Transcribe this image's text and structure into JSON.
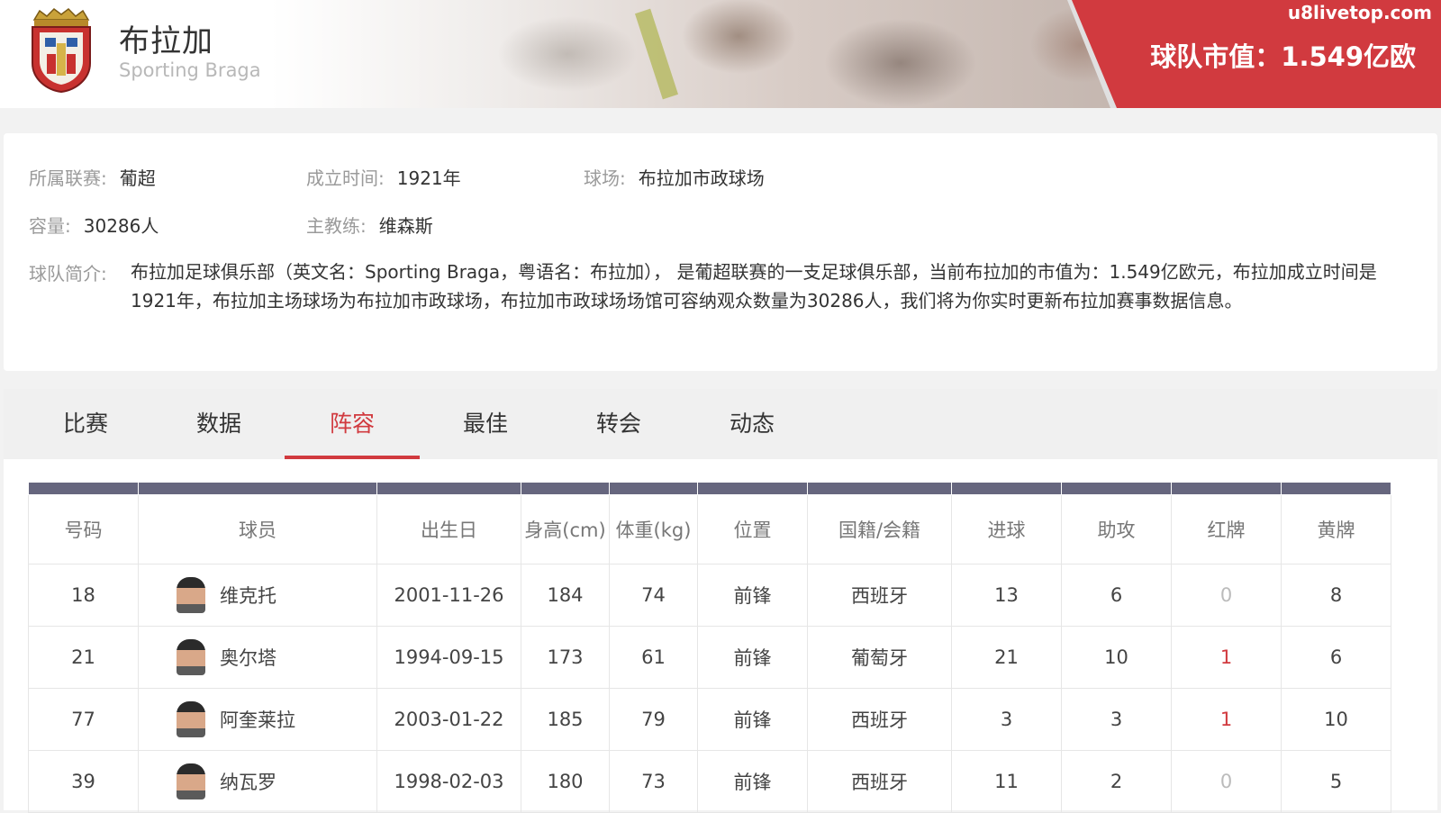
{
  "header": {
    "team_name": "布拉加",
    "team_name_en": "Sporting Braga",
    "watermark": "u8livetop.com",
    "market_value": "球队市值：1.549亿欧"
  },
  "info": {
    "league_label": "所属联赛:",
    "league": "葡超",
    "founded_label": "成立时间:",
    "founded": "1921年",
    "stadium_label": "球场:",
    "stadium": "布拉加市政球场",
    "capacity_label": "容量:",
    "capacity": "30286人",
    "coach_label": "主教练:",
    "coach": "维森斯",
    "intro_label": "球队简介:",
    "intro": "布拉加足球俱乐部（英文名：Sporting Braga，粤语名：布拉加）， 是葡超联赛的一支足球俱乐部，当前布拉加的市值为：1.549亿欧元，布拉加成立时间是1921年，布拉加主场球场为布拉加市政球场，布拉加市政球场场馆可容纳观众数量为30286人，我们将为你实时更新布拉加赛事数据信息。"
  },
  "tabs": [
    "比赛",
    "数据",
    "阵容",
    "最佳",
    "转会",
    "动态"
  ],
  "active_tab": "阵容",
  "roster": {
    "columns": [
      "号码",
      "球员",
      "出生日",
      "身高(cm)",
      "体重(kg)",
      "位置",
      "国籍/会籍",
      "进球",
      "助攻",
      "红牌",
      "黄牌"
    ],
    "rows": [
      {
        "number": "18",
        "name": "维克托",
        "birth": "2001-11-26",
        "height": "184",
        "weight": "74",
        "position": "前锋",
        "nationality": "西班牙",
        "goals": "13",
        "assists": "6",
        "red": "0",
        "yellow": "8"
      },
      {
        "number": "21",
        "name": "奥尔塔",
        "birth": "1994-09-15",
        "height": "173",
        "weight": "61",
        "position": "前锋",
        "nationality": "葡萄牙",
        "goals": "21",
        "assists": "10",
        "red": "1",
        "yellow": "6"
      },
      {
        "number": "77",
        "name": "阿奎莱拉",
        "birth": "2003-01-22",
        "height": "185",
        "weight": "79",
        "position": "前锋",
        "nationality": "西班牙",
        "goals": "3",
        "assists": "3",
        "red": "1",
        "yellow": "10"
      },
      {
        "number": "39",
        "name": "纳瓦罗",
        "birth": "1998-02-03",
        "height": "180",
        "weight": "73",
        "position": "前锋",
        "nationality": "西班牙",
        "goals": "11",
        "assists": "2",
        "red": "0",
        "yellow": "5"
      }
    ]
  },
  "colors": {
    "accent_red": "#d13a3f",
    "table_bar": "#66667e"
  }
}
